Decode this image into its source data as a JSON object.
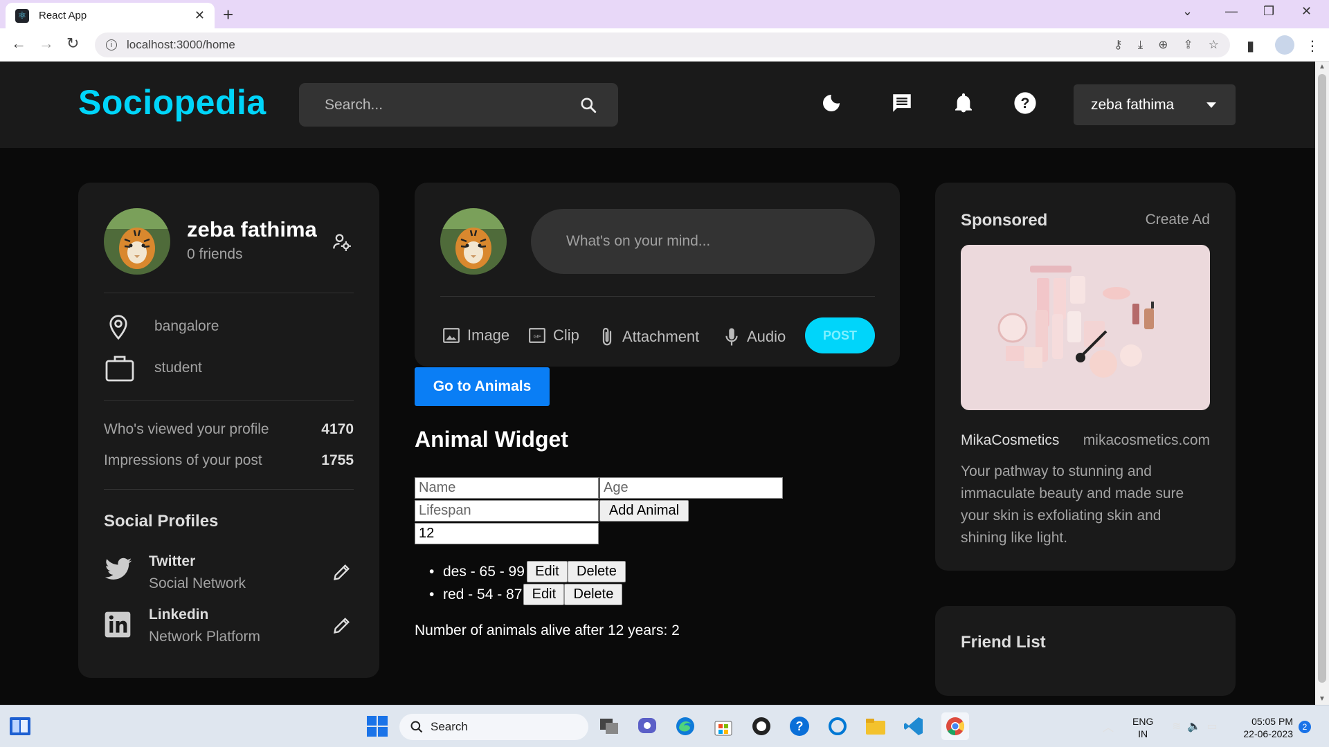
{
  "browser": {
    "tab_title": "React App",
    "tab_favicon": "react-icon",
    "url": "localhost:3000/home"
  },
  "app": {
    "brand": "Sociopedia",
    "search_placeholder": "Search...",
    "user_name": "zeba fathima"
  },
  "profile": {
    "name": "zeba fathima",
    "friends": "0 friends",
    "location": "bangalore",
    "occupation": "student",
    "stats": [
      {
        "label": "Who's viewed your profile",
        "value": "4170"
      },
      {
        "label": "Impressions of your post",
        "value": "1755"
      }
    ],
    "social_title": "Social Profiles",
    "socials": [
      {
        "name": "Twitter",
        "sub": "Social Network"
      },
      {
        "name": "Linkedin",
        "sub": "Network Platform"
      }
    ]
  },
  "post": {
    "placeholder": "What's on your mind...",
    "actions": [
      "Image",
      "Clip",
      "Attachment",
      "Audio"
    ],
    "post_label": "POST"
  },
  "animals": {
    "goto_label": "Go to Animals",
    "title": "Animal Widget",
    "name_placeholder": "Name",
    "age_placeholder": "Age",
    "lifespan_placeholder": "Lifespan",
    "add_label": "Add Animal",
    "years_value": "12",
    "items": [
      {
        "text": "des - 65 - 99"
      },
      {
        "text": "red - 54 - 87"
      }
    ],
    "edit_label": "Edit",
    "delete_label": "Delete",
    "summary": "Number of animals alive after 12 years: 2"
  },
  "sponsored": {
    "title": "Sponsored",
    "create_ad": "Create Ad",
    "brand": "MikaCosmetics",
    "website": "mikacosmetics.com",
    "description": "Your pathway to stunning and immaculate beauty and made sure your skin is exfoliating skin and shining like light."
  },
  "friends": {
    "title": "Friend List"
  },
  "taskbar": {
    "search_label": "Search",
    "lang_top": "ENG",
    "lang_bottom": "IN",
    "time": "05:05 PM",
    "date": "22-06-2023",
    "notification_count": "2"
  },
  "colors": {
    "brand": "#00d5fa",
    "background": "#0a0a0a",
    "card": "#1a1a1a",
    "button_primary": "#0a7ef5"
  }
}
